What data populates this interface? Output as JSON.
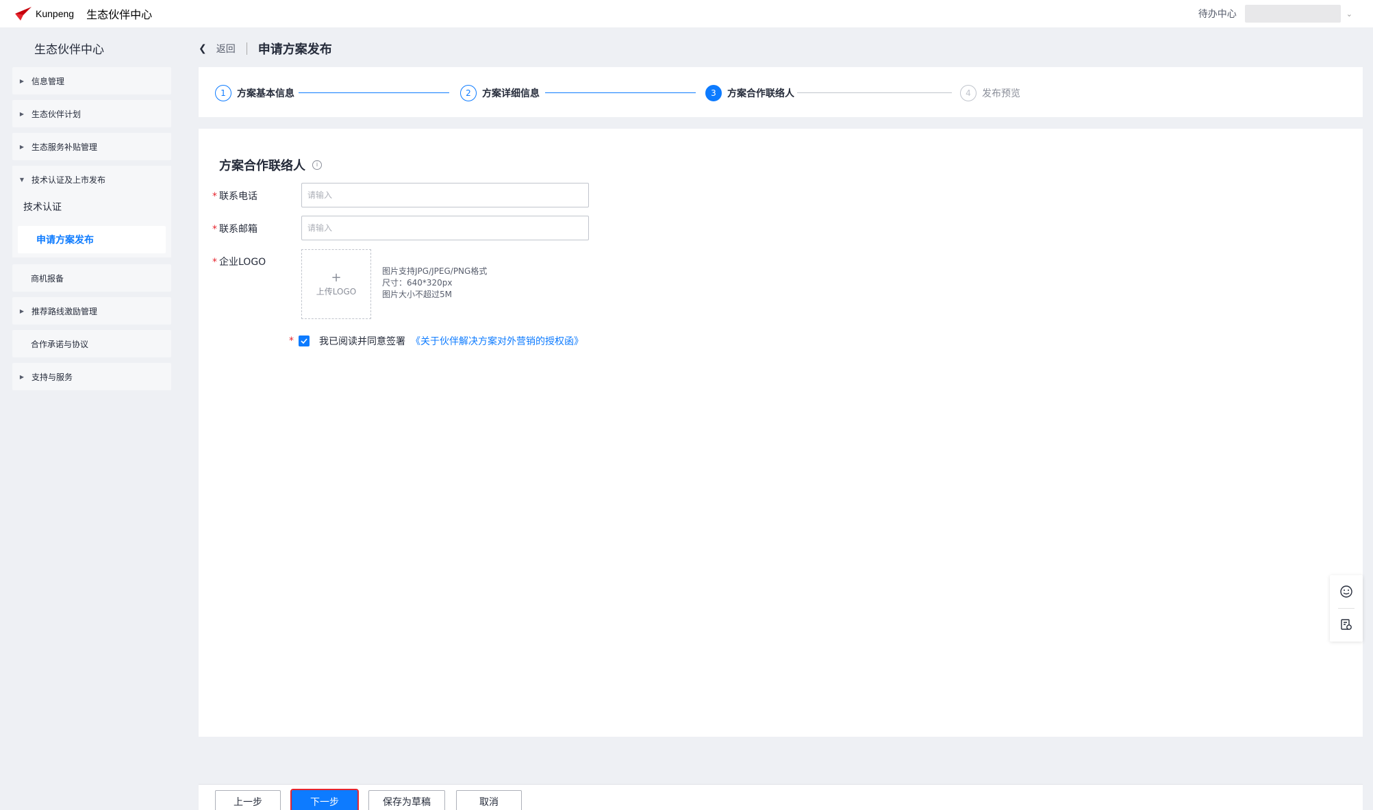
{
  "topbar": {
    "logo_text": "Kunpeng",
    "app_title": "生态伙伴中心",
    "todo_label": "待办中心"
  },
  "sidebar": {
    "title": "生态伙伴中心",
    "items": [
      {
        "label": "信息管理",
        "has_arrow": true
      },
      {
        "label": "生态伙伴计划",
        "has_arrow": true
      },
      {
        "label": "生态服务补贴管理",
        "has_arrow": true
      },
      {
        "label": "技术认证及上市发布",
        "has_arrow": true,
        "expanded": true
      },
      {
        "label": "商机报备",
        "has_arrow": false
      },
      {
        "label": "推荐路线激励管理",
        "has_arrow": true
      },
      {
        "label": "合作承诺与协议",
        "has_arrow": false
      },
      {
        "label": "支持与服务",
        "has_arrow": true
      }
    ],
    "sub_items": [
      {
        "label": "技术认证"
      },
      {
        "label": "申请方案发布",
        "active": true
      }
    ]
  },
  "header": {
    "back_label": "返回",
    "title": "申请方案发布"
  },
  "steps": [
    {
      "num": "1",
      "label": "方案基本信息",
      "state": "done"
    },
    {
      "num": "2",
      "label": "方案详细信息",
      "state": "done"
    },
    {
      "num": "3",
      "label": "方案合作联络人",
      "state": "active"
    },
    {
      "num": "4",
      "label": "发布预览",
      "state": "pending"
    }
  ],
  "form": {
    "section_title": "方案合作联络人",
    "phone": {
      "label": "联系电话",
      "placeholder": "请输入",
      "value": ""
    },
    "email": {
      "label": "联系邮箱",
      "placeholder": "请输入",
      "value": ""
    },
    "logo": {
      "label": "企业LOGO",
      "upload_text": "上传LOGO",
      "hints": [
        "图片支持JPG/JPEG/PNG格式",
        "尺寸：640*320px",
        "图片大小不超过5M"
      ]
    },
    "agreement": {
      "checked": true,
      "text": "我已阅读并同意签署",
      "link": "《关于伙伴解决方案对外营销的授权函》"
    }
  },
  "footer": {
    "prev_label": "上一步",
    "next_label": "下一步",
    "draft_label": "保存为草稿",
    "cancel_label": "取消"
  },
  "colors": {
    "primary": "#0d7bff",
    "required": "#e6252e",
    "background": "#eef0f4"
  }
}
